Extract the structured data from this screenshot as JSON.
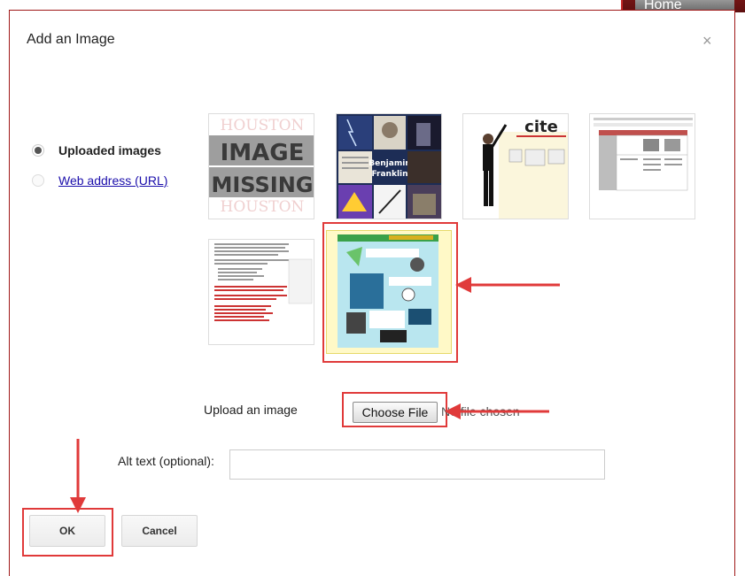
{
  "header": {
    "home_tab": "Home"
  },
  "dialog": {
    "title": "Add an Image",
    "close_glyph": "×",
    "source": {
      "uploaded_label": "Uploaded images",
      "url_label": "Web address (URL)",
      "selected": "uploaded"
    },
    "thumbnails": {
      "missing_line1": "IMAGE",
      "missing_line2": "MISSING",
      "missing_watermark": "HOUSTON",
      "franklin_line1": "Benjamin",
      "franklin_line2": "Franklin",
      "cite_logo": "cite",
      "selected_index": 5
    },
    "upload": {
      "label": "Upload an image",
      "button_label": "Choose File",
      "status": "No file chosen"
    },
    "alt": {
      "label": "Alt text (optional):",
      "value": ""
    },
    "buttons": {
      "ok": "OK",
      "cancel": "Cancel"
    }
  },
  "colors": {
    "annotation_red": "#e03a3a",
    "dialog_border": "#a01818",
    "link": "#1a0dab"
  }
}
